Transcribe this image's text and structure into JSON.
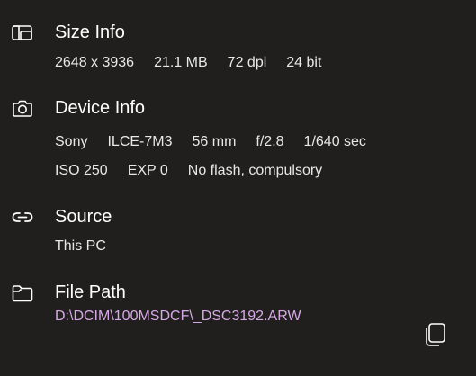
{
  "size_info": {
    "title": "Size Info",
    "icon": "resize-image-icon",
    "values": [
      "2648 x 3936",
      "21.1 MB",
      "72 dpi",
      "24 bit"
    ]
  },
  "device_info": {
    "title": "Device Info",
    "icon": "camera-icon",
    "row1": [
      "Sony",
      "ILCE-7M3",
      "56 mm",
      "f/2.8",
      "1/640 sec"
    ],
    "row2": [
      "ISO 250",
      "EXP 0",
      "No flash, compulsory"
    ]
  },
  "source": {
    "title": "Source",
    "icon": "link-icon",
    "value": "This PC"
  },
  "file_path": {
    "title": "File Path",
    "icon": "folder-icon",
    "value": "D:\\DCIM\\100MSDCF\\_DSC3192.ARW",
    "link_color": "#d7a8e6",
    "copy_icon": "copy-icon"
  }
}
